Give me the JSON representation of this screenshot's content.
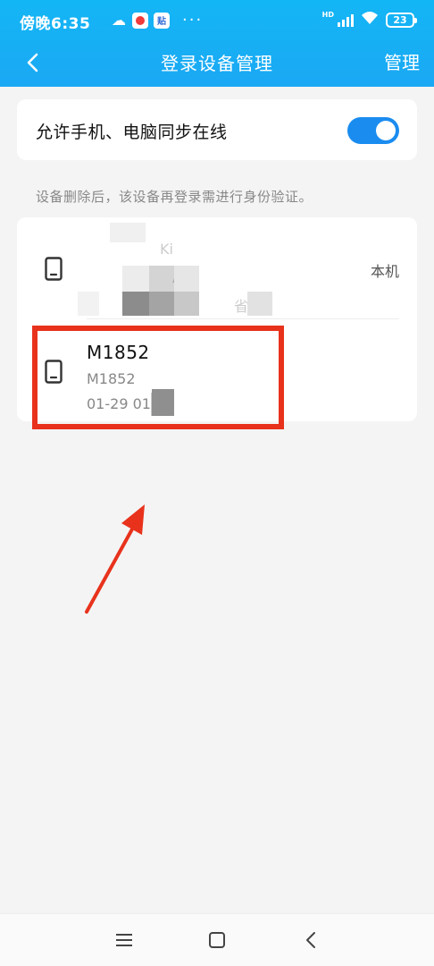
{
  "status_bar": {
    "time": "傍晚6:35",
    "more": "···",
    "hd": "HD",
    "battery": "23",
    "app_badge": "贴"
  },
  "nav": {
    "title": "登录设备管理",
    "action_label": "管理",
    "back_icon": "chevron-left-icon"
  },
  "sync_setting": {
    "label": "允许手机、电脑同步在线",
    "enabled": true
  },
  "hint": "设备删除后，该设备再登录需进行身份验证。",
  "devices": [
    {
      "name": "",
      "model": "",
      "time": "",
      "tag": "本机",
      "obscured": true,
      "visible_fragments": [
        "Ki",
        "AC",
        "省"
      ]
    },
    {
      "name": "M1852",
      "model": "M1852",
      "time": "01-29 01:4",
      "obscured_tail": true
    }
  ],
  "colors": {
    "header": "#16b0f5",
    "switch_on": "#1a8cf0",
    "annotation": "#e8321c",
    "background": "#f4f4f4"
  },
  "system_nav": {
    "menu_icon": "menu-icon",
    "home_icon": "home-icon",
    "back_icon": "back-icon"
  }
}
